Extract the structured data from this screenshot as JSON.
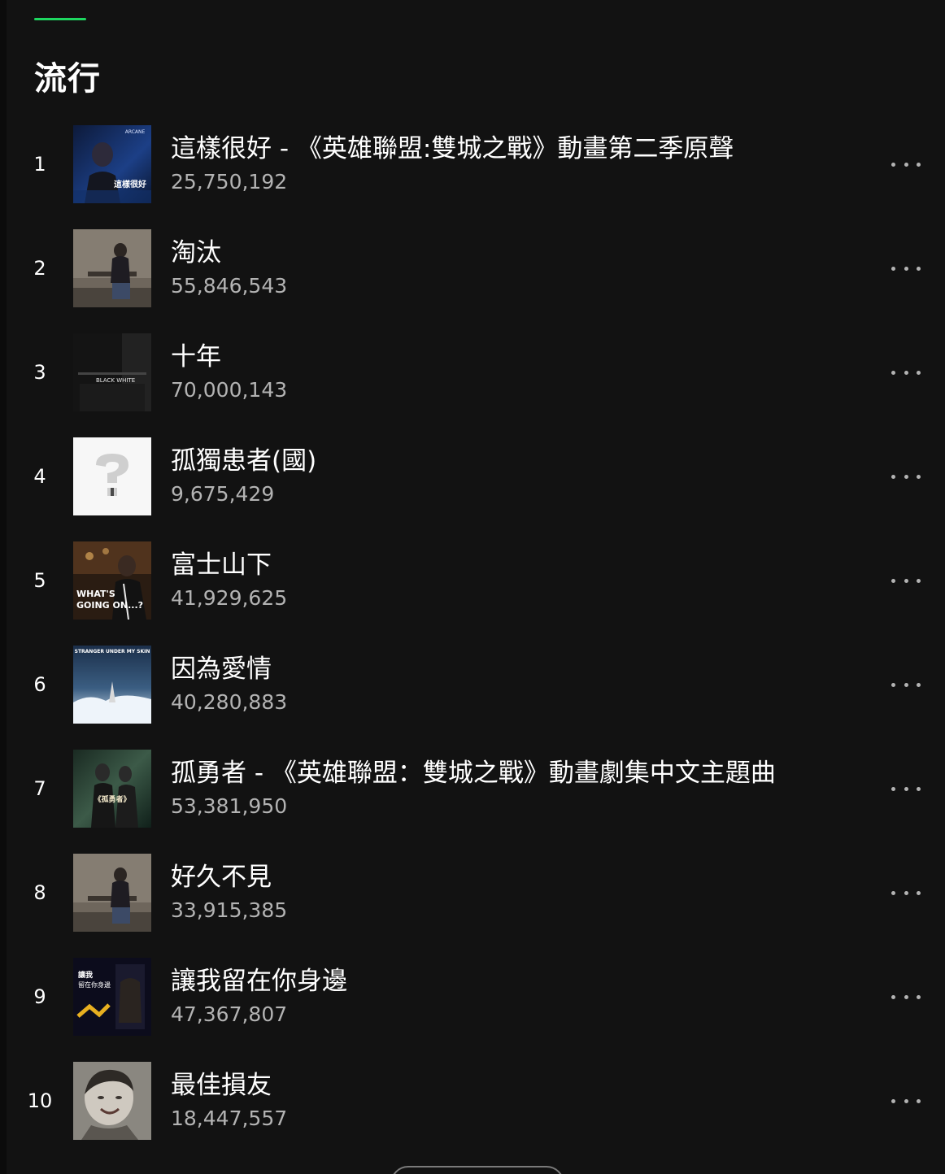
{
  "section": {
    "title": "流行"
  },
  "tracks": [
    {
      "rank": "1",
      "title": "這樣很好 - 《英雄聯盟:雙城之戰》動畫第二季原聲",
      "plays": "25,750,192",
      "cover_text": [
        "ARCANE",
        "這樣很好"
      ]
    },
    {
      "rank": "2",
      "title": "淘汰",
      "plays": "55,846,543"
    },
    {
      "rank": "3",
      "title": "十年",
      "plays": "70,000,143",
      "cover_text": [
        "BLACK WHITE"
      ]
    },
    {
      "rank": "4",
      "title": "孤獨患者(國)",
      "plays": "9,675,429"
    },
    {
      "rank": "5",
      "title": "富士山下",
      "plays": "41,929,625",
      "cover_text": [
        "WHAT'S",
        "GOING ON...?"
      ]
    },
    {
      "rank": "6",
      "title": "因為愛情",
      "plays": "40,280,883",
      "cover_text": [
        "STRANGER UNDER MY SKIN"
      ]
    },
    {
      "rank": "7",
      "title": "孤勇者 - 《英雄聯盟：雙城之戰》動畫劇集中文主題曲",
      "plays": "53,381,950",
      "cover_text": [
        "《孤勇者》"
      ]
    },
    {
      "rank": "8",
      "title": "好久不見",
      "plays": "33,915,385"
    },
    {
      "rank": "9",
      "title": "讓我留在你身邊",
      "plays": "47,367,807",
      "cover_text": [
        "讓我",
        "留在你身邊"
      ]
    },
    {
      "rank": "10",
      "title": "最佳損友",
      "plays": "18,447,557"
    }
  ],
  "colors": {
    "background": "#121212",
    "accent": "#1ed760",
    "primary_text": "#ffffff",
    "secondary_text": "#b3b3b3"
  },
  "icons": {
    "more": "more-horizontal-icon"
  }
}
